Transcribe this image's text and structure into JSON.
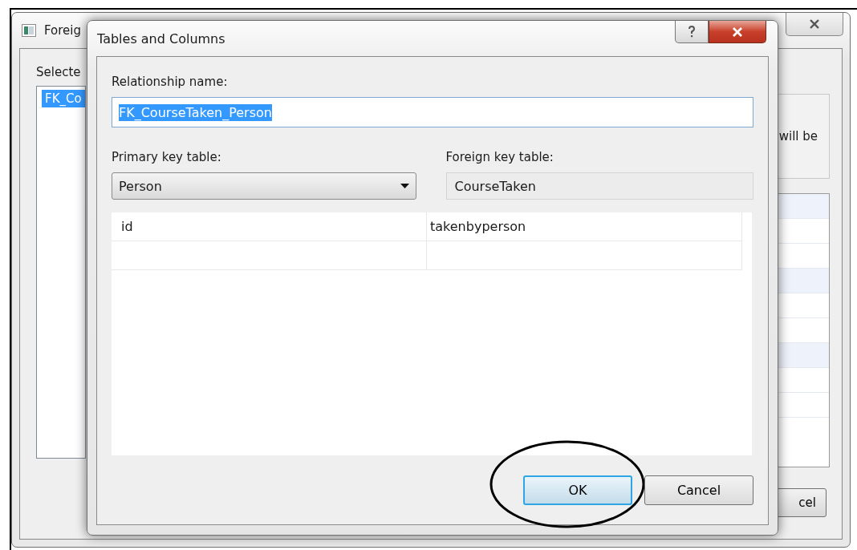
{
  "back_window": {
    "title": "Foreig",
    "list_label": "Selecte",
    "list_items": [
      {
        "text": "FK_Co",
        "selected": true
      }
    ],
    "description": "will be",
    "cancel_button": "cel"
  },
  "dialog": {
    "title": "Tables and Columns",
    "relationship_name": {
      "label": "Relationship name:",
      "value": "FK_CourseTaken_Person",
      "text_selected": true
    },
    "primary_key_table": {
      "label": "Primary key table:",
      "value": "Person"
    },
    "foreign_key_table": {
      "label": "Foreign key table:",
      "value": "CourseTaken"
    },
    "columns_grid": {
      "rows": [
        {
          "column_1": "id",
          "column_2": "takenbyperson"
        }
      ]
    },
    "buttons": [
      {
        "label": "OK",
        "default": true,
        "circled": true
      },
      {
        "label": "Cancel",
        "default": false,
        "circled": false
      }
    ]
  }
}
